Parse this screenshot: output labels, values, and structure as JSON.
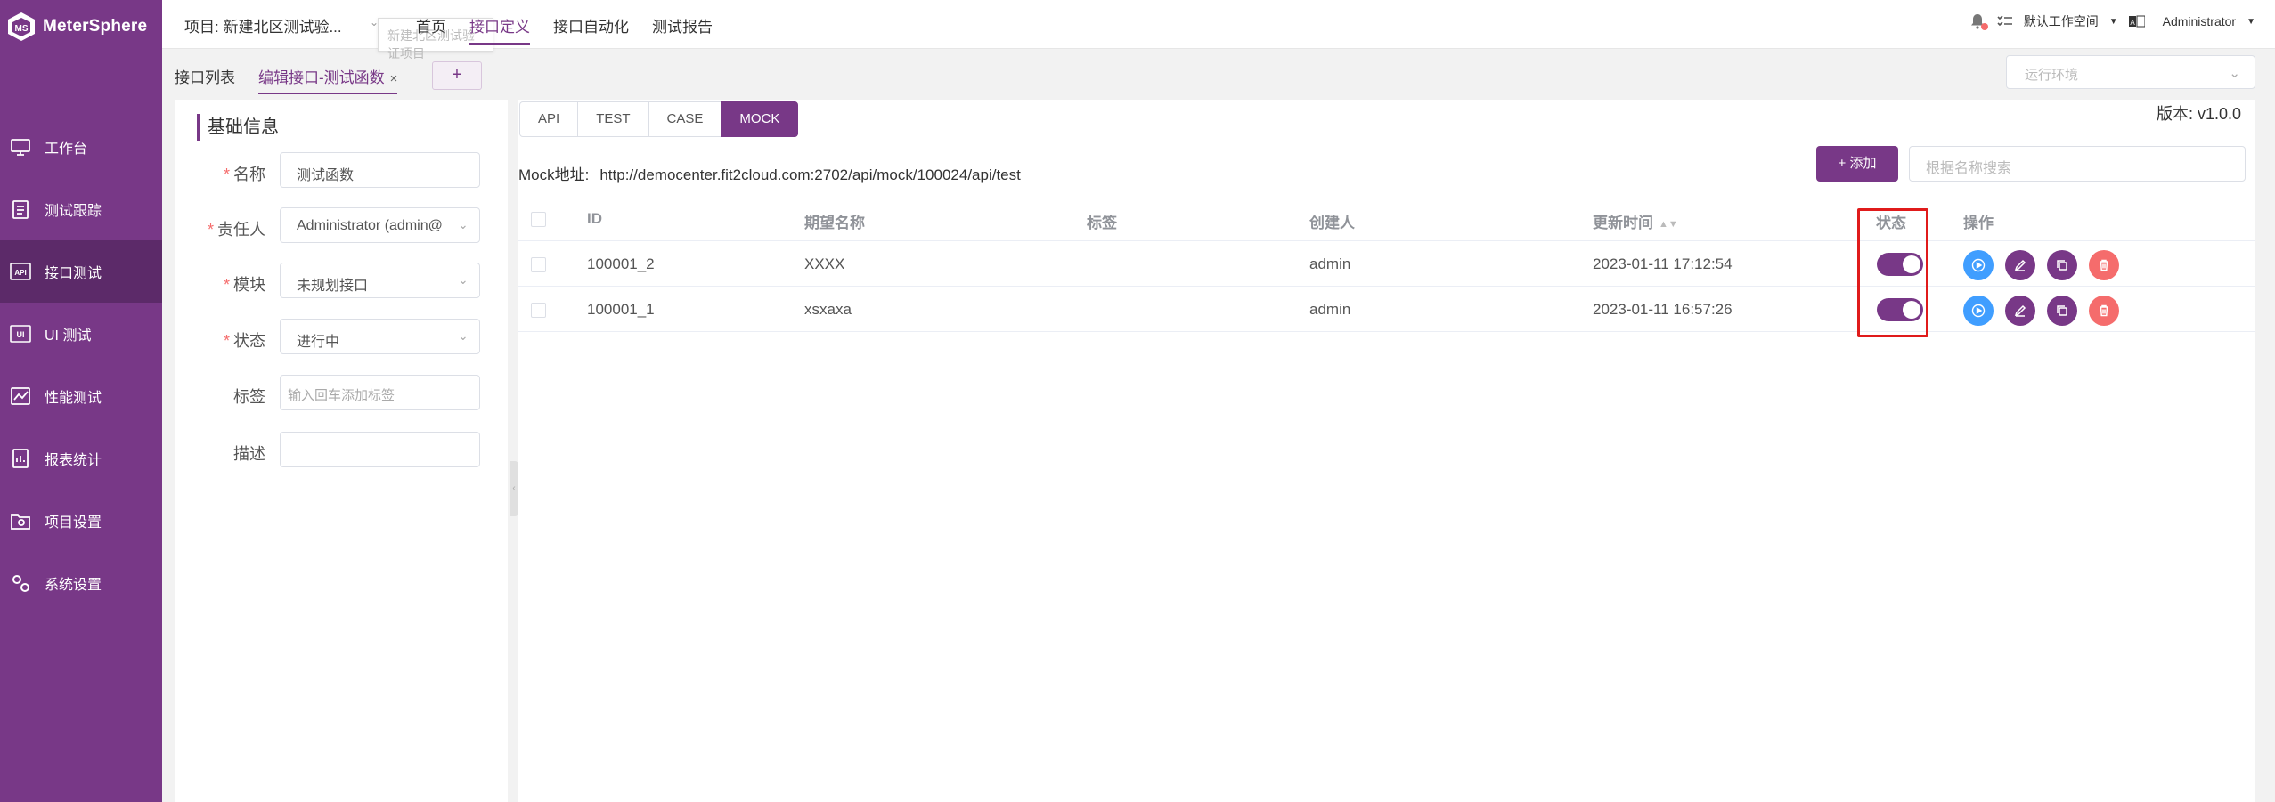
{
  "brand": {
    "name": "MeterSphere"
  },
  "sidebar": {
    "items": [
      {
        "label": "工作台",
        "icon": "monitor-icon"
      },
      {
        "label": "测试跟踪",
        "icon": "clipboard-icon"
      },
      {
        "label": "接口测试",
        "icon": "api-icon",
        "active": true
      },
      {
        "label": "UI 测试",
        "icon": "ui-icon"
      },
      {
        "label": "性能测试",
        "icon": "performance-chart-icon"
      },
      {
        "label": "报表统计",
        "icon": "report-icon"
      },
      {
        "label": "项目设置",
        "icon": "folder-settings-icon"
      },
      {
        "label": "系统设置",
        "icon": "gears-icon"
      }
    ]
  },
  "header": {
    "project": "项目: 新建北区测试验...",
    "project_tooltip": "新建北区测试验证项目",
    "nav": [
      {
        "label": "首页"
      },
      {
        "label": "接口定义",
        "active": true
      },
      {
        "label": "接口自动化"
      },
      {
        "label": "测试报告"
      }
    ],
    "workspace": "默认工作空间",
    "language_icon": "language-icon",
    "user": "Administrator"
  },
  "tabs": {
    "list": "接口列表",
    "edit": "编辑接口-测试函数",
    "close": "×",
    "add": "+"
  },
  "env": {
    "placeholder": "运行环境"
  },
  "form": {
    "section_title": "基础信息",
    "name_label": "名称",
    "name_value": "测试函数",
    "owner_label": "责任人",
    "owner_value": "Administrator (admin@",
    "module_label": "模块",
    "module_value": "未规划接口",
    "status_label": "状态",
    "status_value": "进行中",
    "tags_label": "标签",
    "tags_placeholder": "输入回车添加标签",
    "desc_label": "描述"
  },
  "main": {
    "segments": [
      "API",
      "TEST",
      "CASE",
      "MOCK"
    ],
    "active_segment": "MOCK",
    "version": "版本: v1.0.0",
    "mock_label": "Mock地址:",
    "mock_url": "http://democenter.fit2cloud.com:2702/api/mock/100024/api/test",
    "add_button": "+ 添加",
    "search_placeholder": "根据名称搜索"
  },
  "table": {
    "headers": {
      "id": "ID",
      "name": "期望名称",
      "tags": "标签",
      "creator": "创建人",
      "updated": "更新时间",
      "status": "状态",
      "ops": "操作"
    },
    "rows": [
      {
        "id": "100001_2",
        "name": "XXXX",
        "tags": "",
        "creator": "admin",
        "updated": "2023-01-11 17:12:54",
        "enabled": true
      },
      {
        "id": "100001_1",
        "name": "xsxaxa",
        "tags": "",
        "creator": "admin",
        "updated": "2023-01-11 16:57:26",
        "enabled": true
      }
    ]
  },
  "colors": {
    "accent": "#783887",
    "sidebar_active": "#5c2a69",
    "run": "#409eff",
    "delete": "#f56c6c",
    "highlight": "#e01b1b"
  }
}
